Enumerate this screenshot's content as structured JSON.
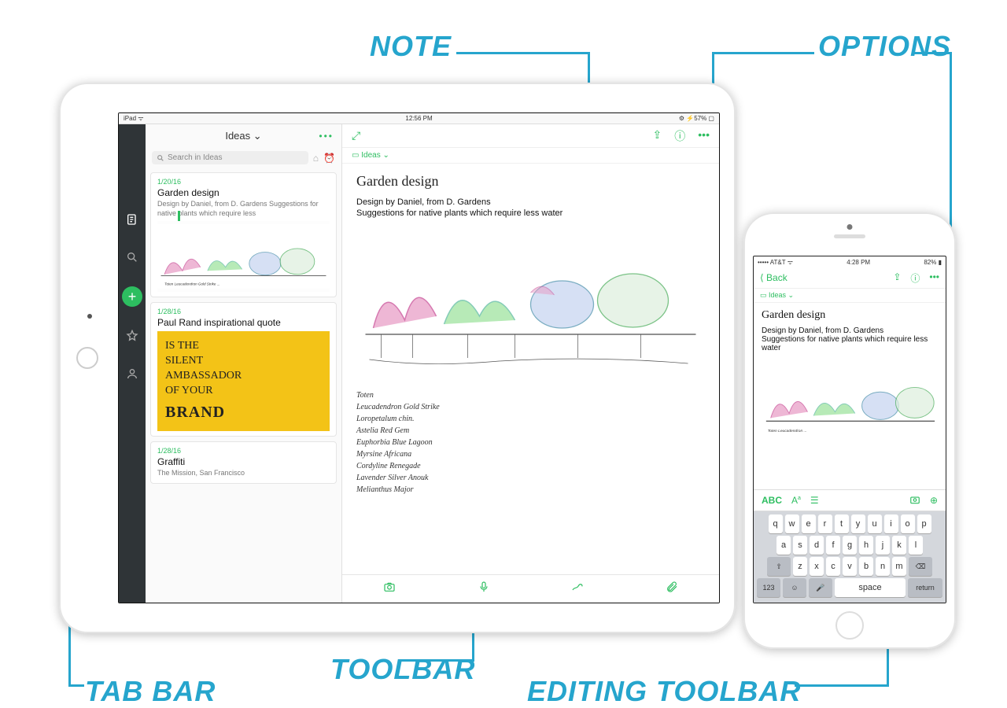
{
  "callouts": {
    "note": "NOTE",
    "options": "OPTIONS",
    "toolbar": "TOOLBAR",
    "tabbar": "TAB BAR",
    "editing_toolbar": "EDITING TOOLBAR"
  },
  "ipad": {
    "status": {
      "left": "iPad ᯤ",
      "time": "12:56 PM",
      "right": "⚙ ⚡57% ▢"
    },
    "list": {
      "header": "Ideas ⌄",
      "header_opts": "•••",
      "search_placeholder": "Search in Ideas",
      "cards": [
        {
          "date": "1/20/16",
          "title": "Garden design",
          "body": "Design by Daniel, from D. Gardens\nSuggestions for native plants which require less"
        },
        {
          "date": "1/28/16",
          "title": "Paul Rand inspirational quote",
          "quote_lines": [
            "IS THE",
            "SILENT",
            "AMBASSADOR",
            "OF YOUR"
          ],
          "quote_brand": "BRAND"
        },
        {
          "date": "1/28/16",
          "title": "Graffiti",
          "body": "The Mission, San Francisco"
        }
      ]
    },
    "note": {
      "crumb": "▭ Ideas ⌄",
      "title": "Garden design",
      "line1": "Design by Daniel, from D. Gardens",
      "line2": "Suggestions for native plants which require less water",
      "handlist": [
        "Toten",
        "Leucadendron Gold Strike",
        "Loropetalum chin.",
        "Astelia Red Gem",
        "Euphorbia Blue Lagoon",
        "Myrsine Africana",
        "Cordyline Renegade",
        "Lavender Silver Anouk",
        "Melianthus Major"
      ]
    },
    "toolbar_icons": [
      "camera-icon",
      "audio-icon",
      "sketch-icon",
      "attachment-icon"
    ]
  },
  "iphone": {
    "status": {
      "left": "••••• AT&T ᯤ",
      "time": "4:28 PM",
      "right": "82% ▮"
    },
    "nav": {
      "back": "⟨ Back"
    },
    "crumb": "▭ Ideas ⌄",
    "title": "Garden design",
    "line1": "Design by Daniel, from D. Gardens",
    "line2": "Suggestions for native plants which require less water",
    "edit": {
      "abc": "ABC"
    },
    "keyboard": {
      "row1": [
        "q",
        "w",
        "e",
        "r",
        "t",
        "y",
        "u",
        "i",
        "o",
        "p"
      ],
      "row2": [
        "a",
        "s",
        "d",
        "f",
        "g",
        "h",
        "j",
        "k",
        "l"
      ],
      "row3": [
        "⇧",
        "z",
        "x",
        "c",
        "v",
        "b",
        "n",
        "m",
        "⌫"
      ],
      "row4": {
        "num": "123",
        "emoji": "☺",
        "mic": "🎤",
        "space": "space",
        "ret": "return"
      }
    }
  }
}
